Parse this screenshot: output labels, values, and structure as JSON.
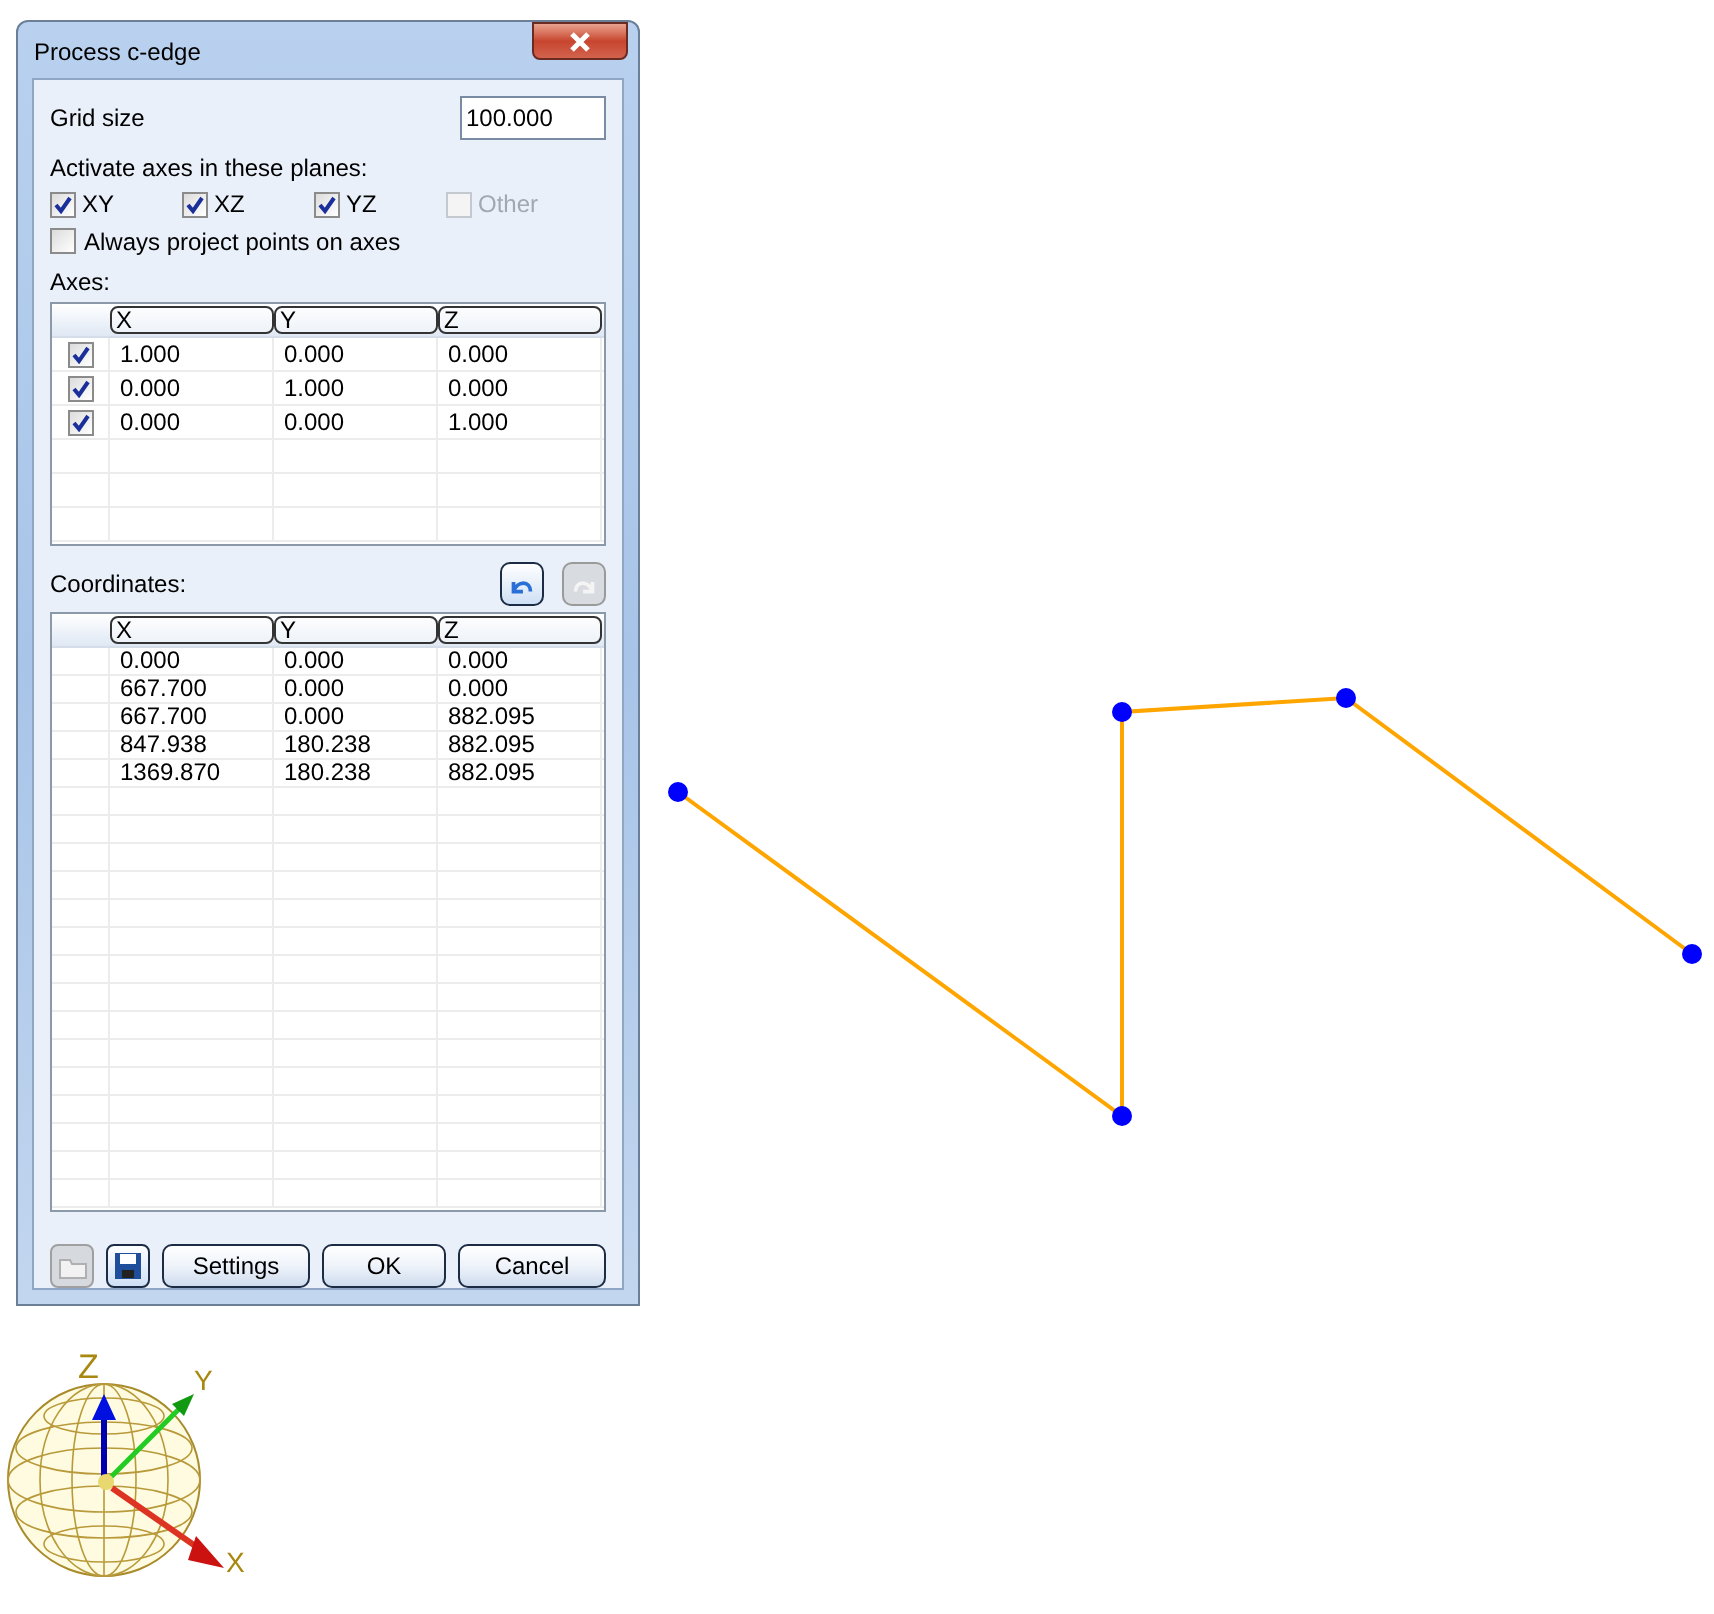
{
  "window": {
    "title": "Process c-edge"
  },
  "grid_size": {
    "label": "Grid size",
    "value": "100.000"
  },
  "planes": {
    "label": "Activate axes in these planes:",
    "items": [
      {
        "label": "XY",
        "checked": true,
        "disabled": false
      },
      {
        "label": "XZ",
        "checked": true,
        "disabled": false
      },
      {
        "label": "YZ",
        "checked": true,
        "disabled": false
      },
      {
        "label": "Other",
        "checked": false,
        "disabled": true
      }
    ]
  },
  "always_project": {
    "label": "Always project points on axes",
    "checked": false
  },
  "axes": {
    "label": "Axes:",
    "columns": [
      "X",
      "Y",
      "Z"
    ],
    "rows": [
      {
        "checked": true,
        "cells": [
          "1.000",
          "0.000",
          "0.000"
        ]
      },
      {
        "checked": true,
        "cells": [
          "0.000",
          "1.000",
          "0.000"
        ]
      },
      {
        "checked": true,
        "cells": [
          "0.000",
          "0.000",
          "1.000"
        ]
      }
    ]
  },
  "coordinates": {
    "label": "Coordinates:",
    "tools": [
      {
        "kind": "undo",
        "disabled": false
      },
      {
        "kind": "redo",
        "disabled": true
      }
    ],
    "columns": [
      "X",
      "Y",
      "Z"
    ],
    "rows": [
      [
        "0.000",
        "0.000",
        "0.000"
      ],
      [
        "667.700",
        "0.000",
        "0.000"
      ],
      [
        "667.700",
        "0.000",
        "882.095"
      ],
      [
        "847.938",
        "180.238",
        "882.095"
      ],
      [
        "1369.870",
        "180.238",
        "882.095"
      ]
    ]
  },
  "icon_buttons": [
    {
      "kind": "open",
      "disabled": true
    },
    {
      "kind": "save",
      "disabled": false
    }
  ],
  "buttons": [
    "Settings",
    "OK",
    "Cancel"
  ],
  "gizmo": {
    "labels": [
      "Z",
      "Y",
      "X"
    ]
  }
}
